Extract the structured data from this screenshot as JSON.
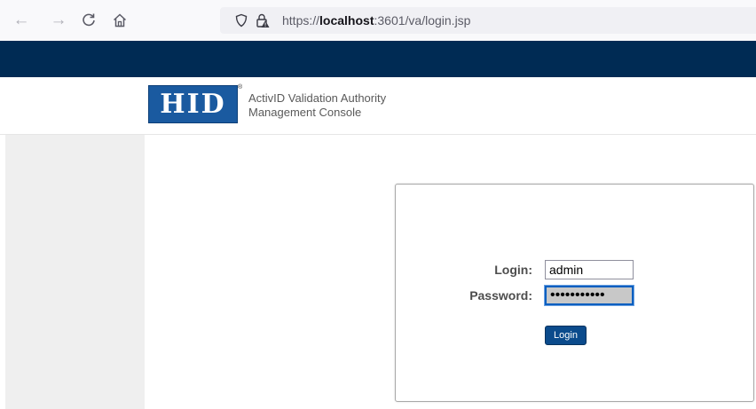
{
  "browser": {
    "back_icon": "arrow-left-icon",
    "forward_icon": "arrow-right-icon",
    "reload_icon": "reload-icon",
    "home_icon": "home-icon",
    "url_prefix": "https://",
    "url_host": "localhost",
    "url_rest": ":3601/va/login.jsp"
  },
  "header": {
    "logo_text": "HID",
    "logo_reg": "®",
    "title_line1": "ActivID Validation Authority",
    "title_line2": "Management Console"
  },
  "login_form": {
    "login_label": "Login:",
    "login_value": "admin",
    "password_label": "Password:",
    "password_mask": "•••••••••••",
    "submit_label": "Login"
  },
  "colors": {
    "banner": "#002b54",
    "logo": "#1a5aa0",
    "button": "#0b4b8c",
    "sidebar": "#efefef"
  }
}
